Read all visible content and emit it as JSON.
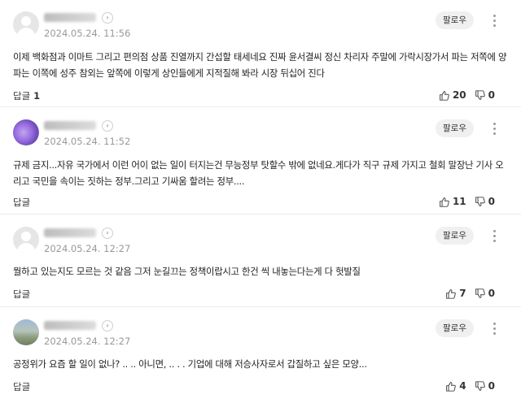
{
  "follow_label": "팔로우",
  "reply_label": "답글",
  "comments": [
    {
      "date": "2024.05.24. 11:56",
      "lines": [
        "이제 백화점과 이마트 그리고 편의점 상품 진열까지 간섭할 태세네요 진짜 윤서결씨 정신 차리자 주말에 가락시장가서 파는 저쪽에 양",
        "파는 이쪽에 성주 참외는 앞쪽에 이렇게 상인들에게 지적질해 봐라 시장 뒤십어 진다"
      ],
      "reply_count": "1",
      "likes": "20",
      "dislikes": "0"
    },
    {
      "date": "2024.05.24. 11:52",
      "lines": [
        "규제 금지...자유 국가에서 이런 어이 없는 일이 터지는건 무능정부 탓할수 밖에 없네요.게다가 직구 규제 가지고 철회 말장난 기사 오",
        "리고 국민을 속이는 짓하는 정부.그리고 기싸움 할려는 정부...."
      ],
      "reply_count": "",
      "likes": "11",
      "dislikes": "0"
    },
    {
      "date": "2024.05.24. 12:27",
      "lines": [
        "뭘하고 있는지도 모르는 것 같음 그저 눈길끄는 정책이랍시고 한건 씩 내놓는다는게 다 헛발질"
      ],
      "reply_count": "",
      "likes": "7",
      "dislikes": "0"
    },
    {
      "date": "2024.05.24. 12:27",
      "lines": [
        "공정위가 요즘 할 일이 없나? .. .. 아니면, .. . . 기업에 대해 저승사자로서 갑질하고 싶은 모양..."
      ],
      "reply_count": "",
      "likes": "4",
      "dislikes": "0"
    }
  ]
}
